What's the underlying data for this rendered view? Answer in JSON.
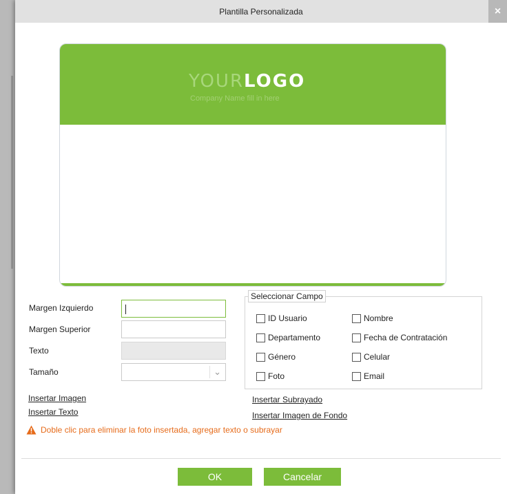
{
  "dialog": {
    "title": "Plantilla Personalizada",
    "close_symbol": "×"
  },
  "card": {
    "logo_part1": "YOUR",
    "logo_part2": "LOGO",
    "tagline": "Company Name fill in here",
    "accent_color": "#7cbc3a"
  },
  "form": {
    "margen_izquierdo": {
      "label": "Margen Izquierdo",
      "value": ""
    },
    "margen_superior": {
      "label": "Margen Superior",
      "value": ""
    },
    "texto": {
      "label": "Texto",
      "value": ""
    },
    "tamano": {
      "label": "Tamaño",
      "value": ""
    }
  },
  "fields": {
    "legend": "Seleccionar Campo",
    "items": [
      {
        "label": "ID Usuario",
        "checked": false
      },
      {
        "label": "Nombre",
        "checked": false
      },
      {
        "label": "Departamento",
        "checked": false
      },
      {
        "label": "Fecha de Contratación",
        "checked": false
      },
      {
        "label": "Género",
        "checked": false
      },
      {
        "label": "Celular",
        "checked": false
      },
      {
        "label": "Foto",
        "checked": false
      },
      {
        "label": "Email",
        "checked": false
      }
    ]
  },
  "links": {
    "insertar_imagen": "Insertar Imagen",
    "insertar_texto": "Insertar Texto",
    "insertar_subrayado": "Insertar Subrayado",
    "insertar_imagen_fondo": "Insertar Imagen de Fondo"
  },
  "warning": {
    "text": "Doble clic para eliminar la foto insertada, agregar texto o subrayar",
    "color": "#e66b1a"
  },
  "buttons": {
    "ok": "OK",
    "cancel": "Cancelar"
  }
}
